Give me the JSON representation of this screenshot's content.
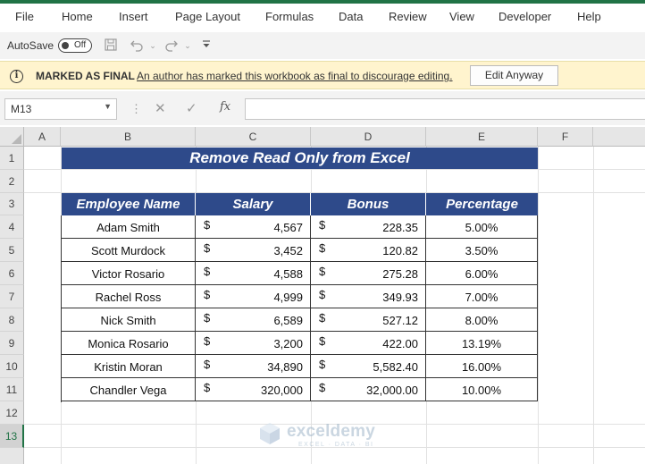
{
  "ribbon": {
    "tabs": [
      "File",
      "Home",
      "Insert",
      "Page Layout",
      "Formulas",
      "Data",
      "Review",
      "View",
      "Developer",
      "Help"
    ]
  },
  "qat": {
    "autosave_label": "AutoSave",
    "autosave_state": "Off",
    "icons": [
      "save-icon",
      "undo-icon",
      "redo-icon",
      "customize-icon"
    ]
  },
  "message_bar": {
    "title": "MARKED AS FINAL",
    "description": "An author has marked this workbook as final to discourage editing.",
    "button_label": "Edit Anyway"
  },
  "formula_bar": {
    "name_box": "M13",
    "cancel_glyph": "✕",
    "enter_glyph": "✓",
    "fx_label": "fx",
    "value": ""
  },
  "grid": {
    "columns": [
      "A",
      "B",
      "C",
      "D",
      "E",
      "F"
    ],
    "rows": [
      "1",
      "2",
      "3",
      "4",
      "5",
      "6",
      "7",
      "8",
      "9",
      "10",
      "11",
      "12",
      "13"
    ],
    "selected_row": "13"
  },
  "sheet": {
    "title": "Remove Read Only from Excel",
    "headers": [
      "Employee Name",
      "Salary",
      "Bonus",
      "Percentage"
    ],
    "currency_symbol": "$",
    "rows": [
      {
        "name": "Adam Smith",
        "salary": "4,567",
        "bonus": "228.35",
        "pct": "5.00%"
      },
      {
        "name": "Scott Murdock",
        "salary": "3,452",
        "bonus": "120.82",
        "pct": "3.50%"
      },
      {
        "name": "Victor Rosario",
        "salary": "4,588",
        "bonus": "275.28",
        "pct": "6.00%"
      },
      {
        "name": "Rachel Ross",
        "salary": "4,999",
        "bonus": "349.93",
        "pct": "7.00%"
      },
      {
        "name": "Nick Smith",
        "salary": "6,589",
        "bonus": "527.12",
        "pct": "8.00%"
      },
      {
        "name": "Monica Rosario",
        "salary": "3,200",
        "bonus": "422.00",
        "pct": "13.19%"
      },
      {
        "name": "Kristin Moran",
        "salary": "34,890",
        "bonus": "5,582.40",
        "pct": "16.00%"
      },
      {
        "name": "Chandler Vega",
        "salary": "320,000",
        "bonus": "32,000.00",
        "pct": "10.00%"
      }
    ]
  },
  "watermark": {
    "name": "exceldemy",
    "tagline": "EXCEL · DATA · BI"
  },
  "colors": {
    "excel_green": "#217346",
    "header_blue": "#2e4a8a",
    "message_bar_bg": "#fff4ce"
  }
}
